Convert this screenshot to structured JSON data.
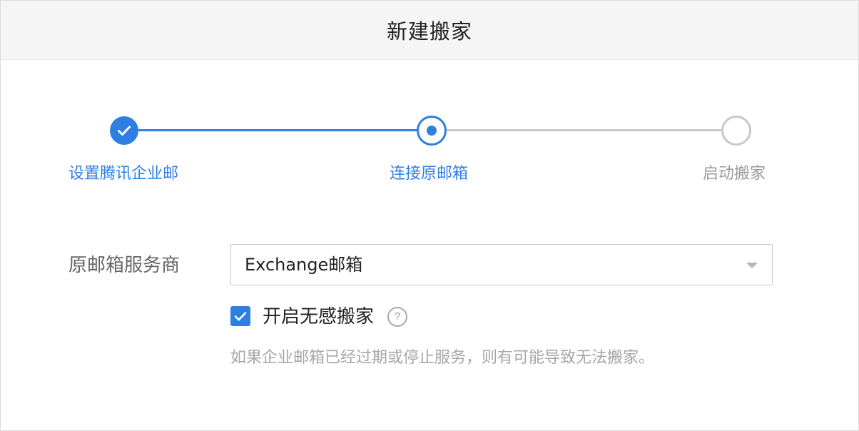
{
  "dialog": {
    "title": "新建搬家"
  },
  "steps": [
    {
      "label": "设置腾讯企业邮",
      "status": "done",
      "icon": "check-icon"
    },
    {
      "label": "连接原邮箱",
      "status": "active",
      "icon": "dot-icon"
    },
    {
      "label": "启动搬家",
      "status": "todo",
      "icon": "empty-circle-icon"
    }
  ],
  "form": {
    "provider_label": "原邮箱服务商",
    "provider_value": "Exchange邮箱",
    "seamless": {
      "label": "开启无感搬家",
      "checked": true,
      "help_icon": "?"
    },
    "hint": "如果企业邮箱已经过期或停止服务，则有可能导致无法搬家。"
  },
  "colors": {
    "accent": "#2f7fe3",
    "inactive": "#c8c8c8",
    "muted_text": "#a6a6a6",
    "header_bg": "#f5f5f5"
  }
}
